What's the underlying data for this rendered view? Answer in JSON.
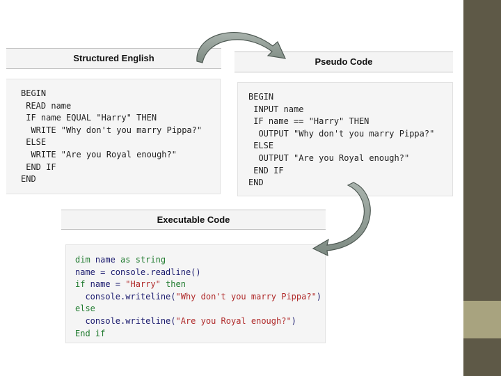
{
  "colors": {
    "sidebar": "#5e5947",
    "sidebar_accent": "#a8a37f",
    "keyword": "#1f7a2e",
    "string": "#b02a2a",
    "arrow_fill": "#8f9a93"
  },
  "panels": {
    "structured_english": {
      "title": "Structured English",
      "lines": [
        "BEGIN",
        " READ name",
        " IF name EQUAL \"Harry\" THEN",
        "  WRITE \"Why don't you marry Pippa?\"",
        " ELSE",
        "  WRITE \"Are you Royal enough?\"",
        " END IF",
        "END"
      ]
    },
    "pseudo_code": {
      "title": "Pseudo Code",
      "lines": [
        "BEGIN",
        " INPUT name",
        " IF name == \"Harry\" THEN",
        "  OUTPUT \"Why don't you marry Pippa?\"",
        " ELSE",
        "  OUTPUT \"Are you Royal enough?\"",
        " END IF",
        "END"
      ]
    },
    "executable_code": {
      "title": "Executable Code",
      "lines": [
        {
          "parts": [
            {
              "t": "dim",
              "k": "kw"
            },
            {
              "t": " name ",
              "k": ""
            },
            {
              "t": "as",
              "k": "kw"
            },
            {
              "t": " ",
              "k": ""
            },
            {
              "t": "string",
              "k": "kw"
            }
          ]
        },
        {
          "parts": [
            {
              "t": "name = console.readline()",
              "k": ""
            }
          ]
        },
        {
          "parts": [
            {
              "t": "if",
              "k": "kw"
            },
            {
              "t": " name = ",
              "k": ""
            },
            {
              "t": "\"Harry\"",
              "k": "str"
            },
            {
              "t": " ",
              "k": ""
            },
            {
              "t": "then",
              "k": "kw"
            }
          ]
        },
        {
          "parts": [
            {
              "t": "  console.writeline(",
              "k": ""
            },
            {
              "t": "\"Why don't you marry Pippa?\"",
              "k": "str"
            },
            {
              "t": ")",
              "k": ""
            }
          ]
        },
        {
          "parts": [
            {
              "t": "else",
              "k": "kw"
            }
          ]
        },
        {
          "parts": [
            {
              "t": "  console.writeline(",
              "k": ""
            },
            {
              "t": "\"Are you Royal enough?\"",
              "k": "str"
            },
            {
              "t": ")",
              "k": ""
            }
          ]
        },
        {
          "parts": [
            {
              "t": "End if",
              "k": "kw"
            }
          ]
        }
      ]
    }
  },
  "arrows": [
    {
      "name": "arrow-english-to-pseudo",
      "icon": "curved-arrow-icon"
    },
    {
      "name": "arrow-pseudo-to-executable",
      "icon": "curved-arrow-icon"
    }
  ]
}
